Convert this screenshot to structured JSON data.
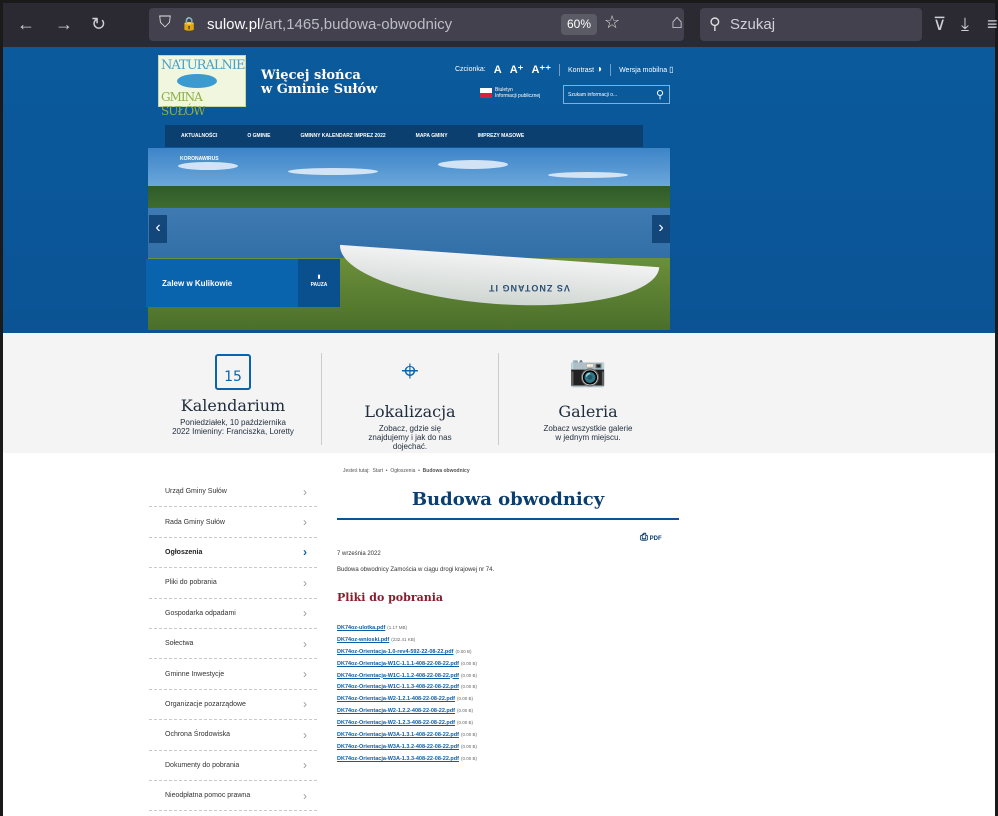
{
  "browser": {
    "url_domain": "sulow.pl",
    "url_path": "/art,1465,budowa-obwodnicy",
    "zoom": "60%",
    "search_placeholder": "Szukaj",
    "icons": {
      "back": "←",
      "forward": "→",
      "reload": "↻",
      "shield": "⛉",
      "lock": "🔒",
      "star": "☆",
      "home": "⌂",
      "search": "⚲",
      "pocket": "⊽",
      "download": "⤓",
      "menu": "≡"
    }
  },
  "header": {
    "logo_line1": "NATURALNIE",
    "logo_line2": "GMINA SUŁÓW",
    "slogan_line1": "Więcej słońca",
    "slogan_line2": "w Gminie Sułów",
    "font_label": "Czcionka:",
    "font_a": "A",
    "font_a_plus": "A⁺",
    "font_a_plusplus": "A⁺⁺",
    "contrast": "Kontrast",
    "mobile": "Wersja mobilna",
    "bip_line1": "Biuletyn",
    "bip_line2": "Informacji publicznej",
    "search_placeholder": "Szukam informacji o...",
    "brand_color": "#0a5a9c"
  },
  "nav": {
    "items": [
      "AKTUALNOŚCI",
      "O GMINIE",
      "GMINNY KALENDARZ IMPREZ 2022",
      "MAPA GMINY",
      "IMPREZY MASOWE"
    ],
    "extra": "KORONAWIRUS"
  },
  "slider": {
    "caption": "Zalew w Kulikowie",
    "pause_label": "PAUZA",
    "boat_text": "VS ZNOTANG IT",
    "prev": "‹",
    "next": "›"
  },
  "features": [
    {
      "title": "Kalendarium",
      "desc": "Poniedziałek, 10 października 2022 Imieniny: Franciszka, Loretty",
      "icon_text": "15"
    },
    {
      "title": "Lokalizacja",
      "desc": "Zobacz, gdzie się znajdujemy i jak do nas dojechać."
    },
    {
      "title": "Galeria",
      "desc": "Zobacz wszystkie galerie w jednym miejscu."
    }
  ],
  "sidebar": {
    "items": [
      "Urząd Gminy Sułów",
      "Rada Gminy Sułów",
      "Ogłoszenia",
      "Pliki do pobrania",
      "Gospodarka odpadami",
      "Sołectwa",
      "Gminne Inwestycje",
      "Organizacje pozarządowe",
      "Ochrona Środowiska",
      "Dokumenty do pobrania",
      "Nieodpłatna pomoc prawna"
    ],
    "active_index": 2
  },
  "content": {
    "breadcrumb_label": "Jesteś tutaj:",
    "breadcrumb": [
      "Start",
      "Ogłoszenia",
      "Budowa obwodnicy"
    ],
    "title": "Budowa obwodnicy",
    "pdf_label": "PDF",
    "date": "7 września 2022",
    "description": "Budowa obwodnicy Zamościa w ciągu drogi krajowej nr 74.",
    "files_heading": "Pliki do pobrania",
    "files": [
      {
        "name": "DK74oz-ulotka.pdf",
        "size": "(1.17 MB)"
      },
      {
        "name": "DK74oz-wnioski.pdf",
        "size": "(232.41 KB)"
      },
      {
        "name": "DK74oz-Orientacja-1.0-rev4-592-22-08-22.pdf",
        "size": "(0.00 B)"
      },
      {
        "name": "DK74oz-Orientacja-W1C-1.1.1-408-22-08-22.pdf",
        "size": "(0.00 B)"
      },
      {
        "name": "DK74oz-Orientacja-W1C-1.1.2-408-22-08-22.pdf",
        "size": "(0.00 B)"
      },
      {
        "name": "DK74oz-Orientacja-W1C-1.1.3-408-22-08-22.pdf",
        "size": "(0.00 B)"
      },
      {
        "name": "DK74oz-Orientacja-W2-1.2.1-408-22-08-22.pdf",
        "size": "(0.00 B)"
      },
      {
        "name": "DK74oz-Orientacja-W2-1.2.2-408-22-08-22.pdf",
        "size": "(0.00 B)"
      },
      {
        "name": "DK74oz-Orientacja-W2-1.2.3-408-22-08-22.pdf",
        "size": "(0.00 B)"
      },
      {
        "name": "DK74oz-Orientacja-W3A-1.3.1-408-22-08-22.pdf",
        "size": "(0.00 B)"
      },
      {
        "name": "DK74oz-Orientacja-W3A-1.3.2-408-22-08-22.pdf",
        "size": "(0.00 B)"
      },
      {
        "name": "DK74oz-Orientacja-W3A-1.3.3-408-22-08-22.pdf",
        "size": "(0.00 B)"
      }
    ]
  }
}
